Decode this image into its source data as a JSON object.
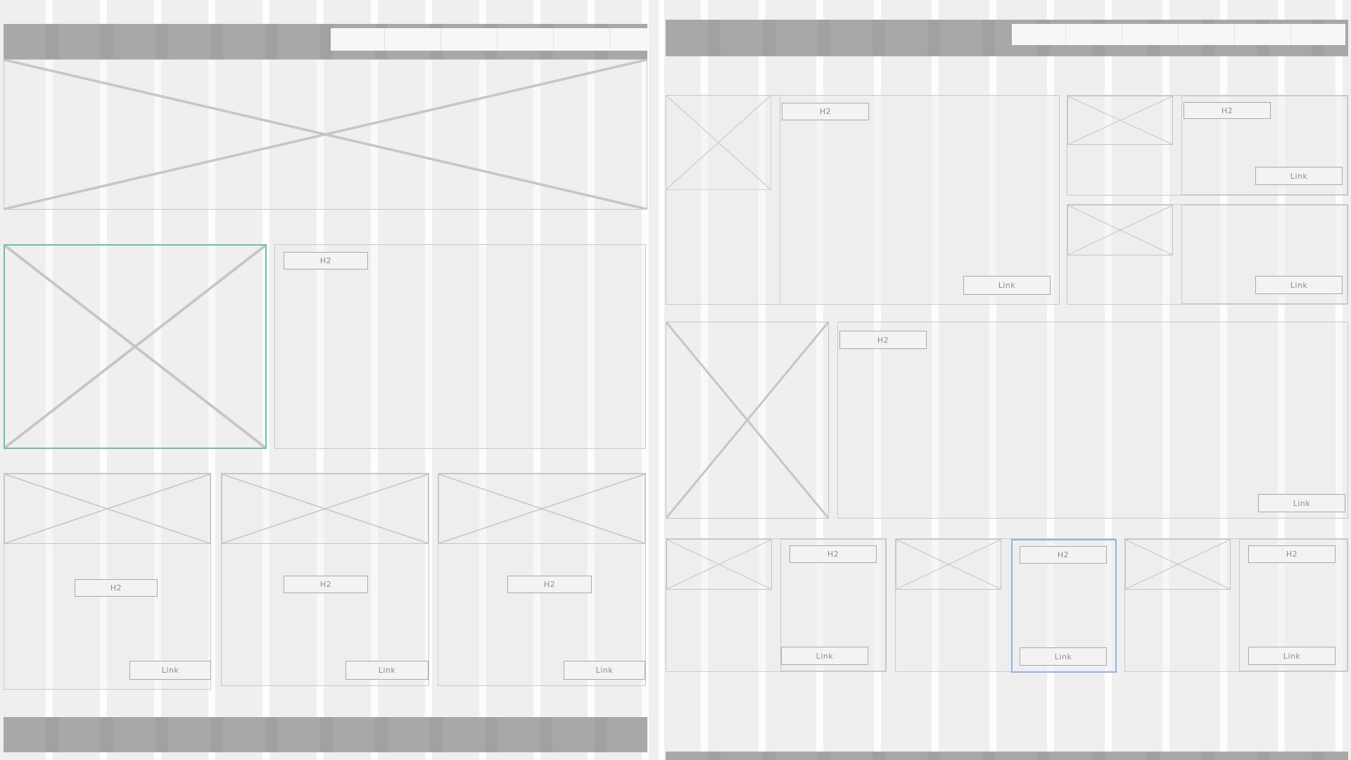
{
  "labels": {
    "heading": "H2",
    "link": "Link"
  },
  "colors": {
    "background": "#e7e7e7",
    "panel": "#efefef",
    "column": "#ffffff",
    "nav_bar": "#a8a8a8",
    "selection_green": "#6fc09f",
    "selection_blue": "#8fb3e2"
  },
  "icons": [
    "image-placeholder-icon"
  ]
}
